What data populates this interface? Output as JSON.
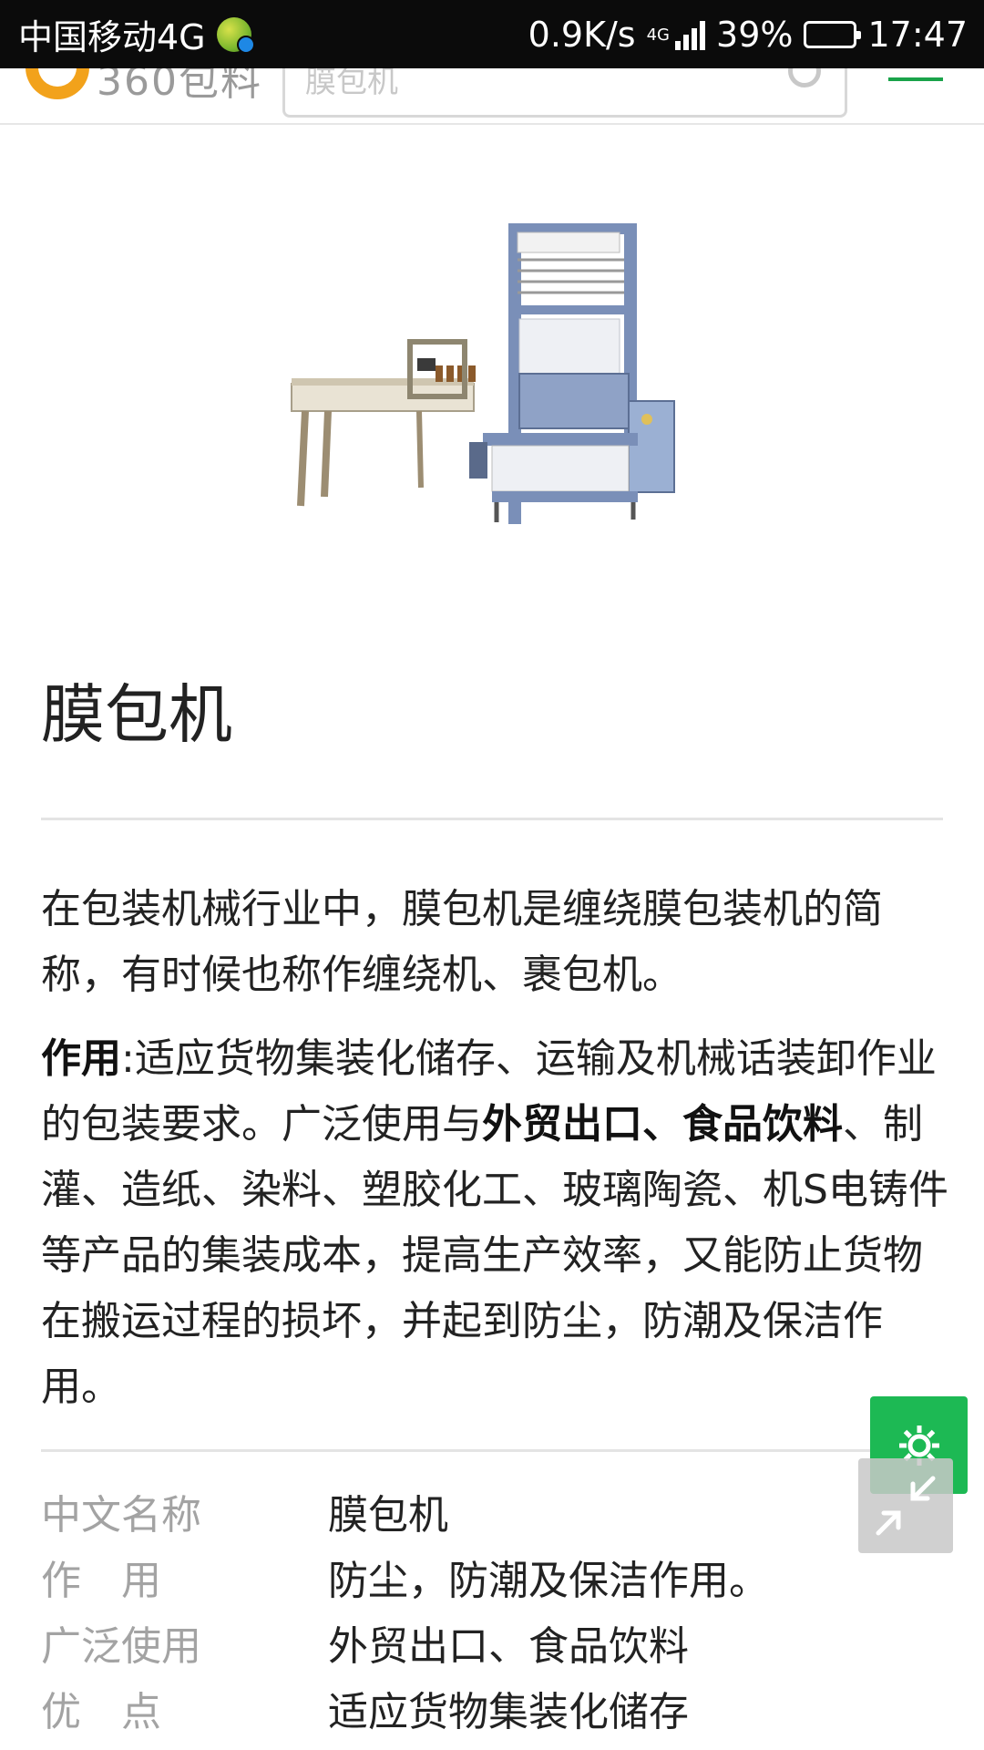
{
  "status_bar": {
    "carrier": "中国移动4G",
    "speed": "0.9K/s",
    "network_type": "4G",
    "battery": "39%",
    "battery_level": 0.39,
    "time": "17:47"
  },
  "header": {
    "logo_text": "360包料",
    "search_placeholder": "膜包机",
    "accent_color": "#1aa34a",
    "logo_color": "#f2a21b"
  },
  "article": {
    "title": "膜包机",
    "intro": "在包装机械行业中，膜包机是缠绕膜包装机的简称，有时候也称作缠绕机、裹包机。",
    "usage": {
      "label": "作用",
      "text_1": ":适应货物集装化储存、运输及机械话装卸作业的包装要求。广泛使用与",
      "bold_1": "外贸出口、食品饮料",
      "text_2": "、制灌、造纸、染料、塑胶化工、玻璃陶瓷、机S电铸件等产品的集装成本，提高生产效率，又能防止货物在搬运过程的损坏，并起到防尘，防潮及保洁作用。"
    }
  },
  "info_table": [
    {
      "label": "中文名称",
      "value": "膜包机"
    },
    {
      "label": "作　用",
      "value": "防尘，防潮及保洁作用。"
    },
    {
      "label": "广泛使用",
      "value": "外贸出口、食品饮料"
    },
    {
      "label": "优　点",
      "value": "适应货物集装化储存"
    }
  ],
  "floating": {
    "settings_icon": "gear-icon",
    "collapse_icon": "collapse-arrows-icon",
    "settings_color": "#1db954"
  }
}
